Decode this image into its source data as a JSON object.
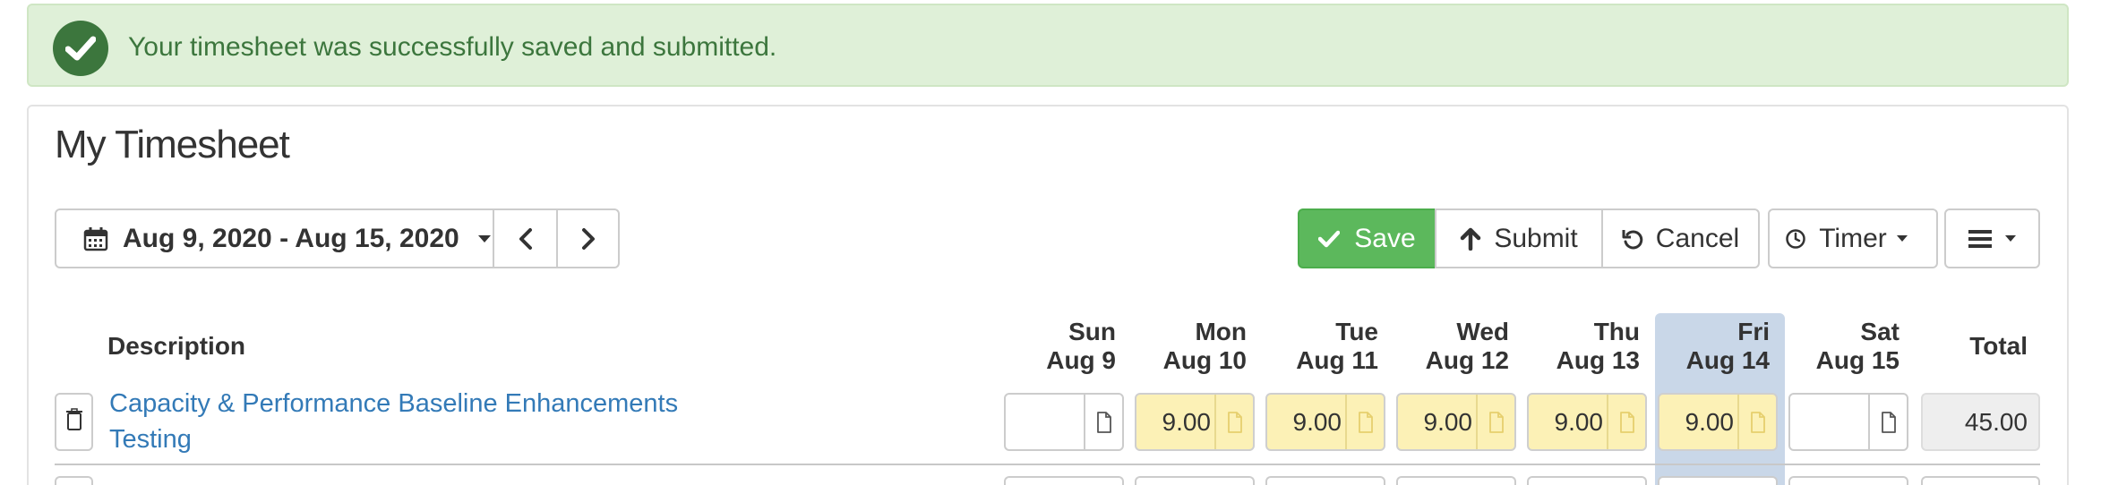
{
  "alert": {
    "message": "Your timesheet was successfully saved and submitted.",
    "icon": "check-circle-icon",
    "color": "#3c763d",
    "background": "#dff0d8"
  },
  "page": {
    "title": "My Timesheet"
  },
  "toolbar": {
    "date_range": "Aug 9, 2020 - Aug 15, 2020",
    "save_label": "Save",
    "submit_label": "Submit",
    "cancel_label": "Cancel",
    "timer_label": "Timer",
    "save_color": "#5cb85c"
  },
  "table": {
    "description_header": "Description",
    "total_header": "Total",
    "days": [
      {
        "day": "Sun",
        "date": "Aug 9"
      },
      {
        "day": "Mon",
        "date": "Aug 10"
      },
      {
        "day": "Tue",
        "date": "Aug 11"
      },
      {
        "day": "Wed",
        "date": "Aug 12"
      },
      {
        "day": "Thu",
        "date": "Aug 13"
      },
      {
        "day": "Fri",
        "date": "Aug 14"
      },
      {
        "day": "Sat",
        "date": "Aug 15"
      }
    ],
    "highlight_color": "#c9d7e8",
    "rows": [
      {
        "project": "Capacity & Performance Baseline Enhancements",
        "task": "Testing",
        "hours": [
          "",
          "9.00",
          "9.00",
          "9.00",
          "9.00",
          "9.00",
          ""
        ],
        "total": "45.00"
      }
    ]
  }
}
